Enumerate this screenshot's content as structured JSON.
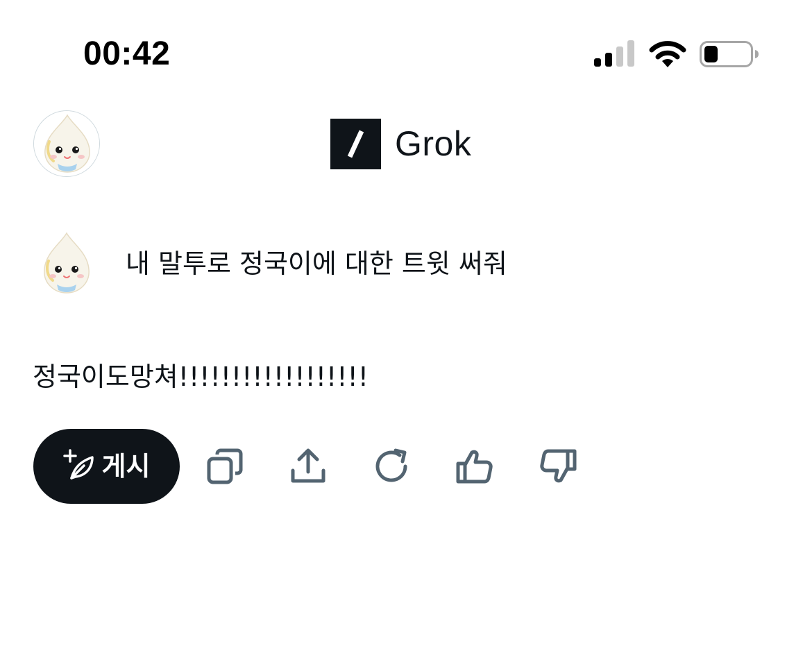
{
  "status_bar": {
    "time": "00:42",
    "signal_icon": "cellular-signal-icon",
    "wifi_icon": "wifi-icon",
    "battery_icon": "battery-icon",
    "battery_level": 0.3
  },
  "header": {
    "avatar_icon": "user-avatar",
    "logo_icon": "grok-logo-icon",
    "app_name": "Grok"
  },
  "conversation": {
    "prompt_avatar_icon": "user-avatar",
    "prompt_text": "내 말투로 정국이에 대한 트윗 써줘",
    "response_text": "정국이도망쳐!!!!!!!!!!!!!!!!!!"
  },
  "actions": {
    "post_label": "게시",
    "post_icon": "compose-post-icon",
    "copy_icon": "copy-icon",
    "share_icon": "share-icon",
    "regenerate_icon": "regenerate-icon",
    "like_icon": "thumbs-up-icon",
    "dislike_icon": "thumbs-down-icon"
  },
  "colors": {
    "text": "#0f1419",
    "icon_gray": "#536471",
    "button_bg": "#0f1419",
    "button_text": "#ffffff",
    "background": "#ffffff"
  }
}
